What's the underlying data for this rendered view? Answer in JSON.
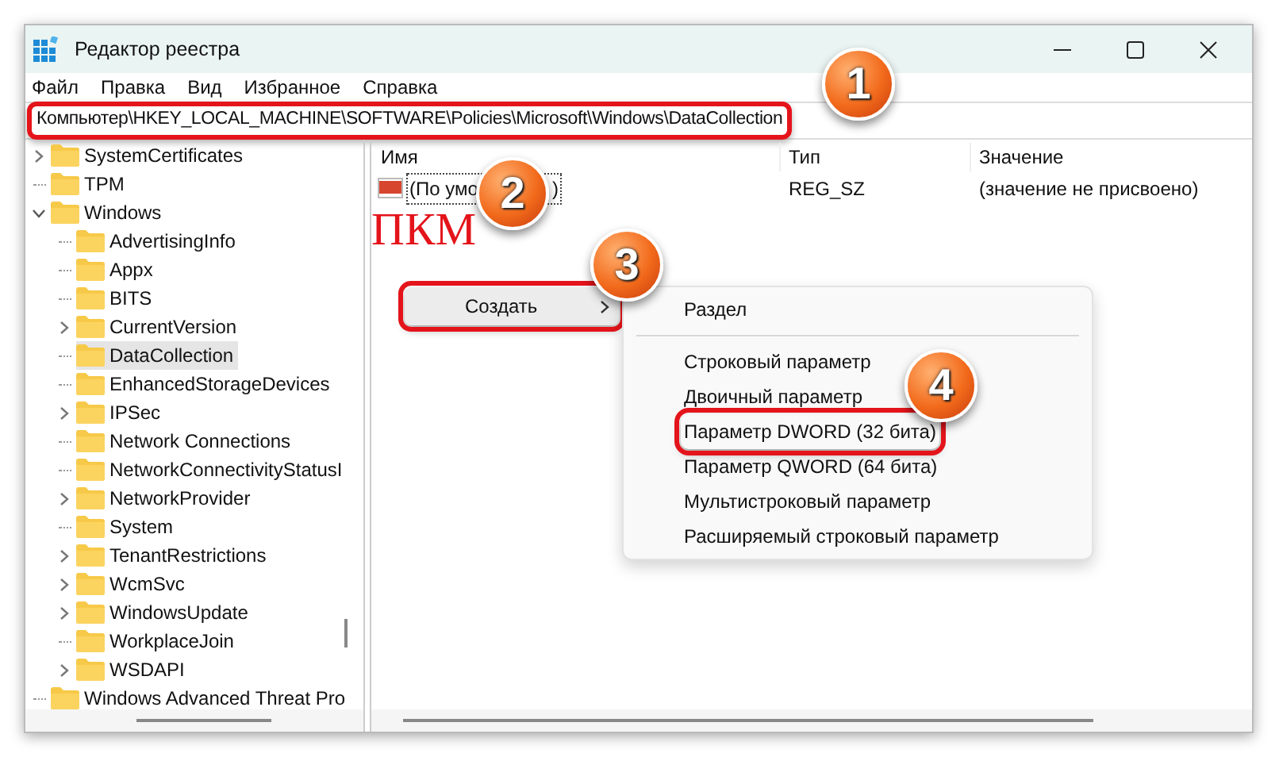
{
  "window": {
    "title": "Редактор реестра"
  },
  "menu": [
    "Файл",
    "Правка",
    "Вид",
    "Избранное",
    "Справка"
  ],
  "address_bar": {
    "value": "Компьютер\\HKEY_LOCAL_MACHINE\\SOFTWARE\\Policies\\Microsoft\\Windows\\DataCollection",
    "highlighted": true
  },
  "tree": [
    {
      "label": "SystemCertificates",
      "expandable": true,
      "expanded": false,
      "selected": false
    },
    {
      "label": "TPM",
      "expandable": false,
      "selected": false
    },
    {
      "label": "Windows",
      "expandable": true,
      "expanded": true,
      "selected": false,
      "children": [
        {
          "label": "AdvertisingInfo",
          "expandable": false,
          "selected": false
        },
        {
          "label": "Appx",
          "expandable": false,
          "selected": false
        },
        {
          "label": "BITS",
          "expandable": false,
          "selected": false
        },
        {
          "label": "CurrentVersion",
          "expandable": true,
          "expanded": false,
          "selected": false
        },
        {
          "label": "DataCollection",
          "expandable": false,
          "selected": true
        },
        {
          "label": "EnhancedStorageDevices",
          "expandable": false,
          "selected": false
        },
        {
          "label": "IPSec",
          "expandable": true,
          "expanded": false,
          "selected": false
        },
        {
          "label": "Network Connections",
          "expandable": false,
          "selected": false
        },
        {
          "label": "NetworkConnectivityStatusI",
          "expandable": false,
          "selected": false
        },
        {
          "label": "NetworkProvider",
          "expandable": true,
          "expanded": false,
          "selected": false
        },
        {
          "label": "System",
          "expandable": false,
          "selected": false
        },
        {
          "label": "TenantRestrictions",
          "expandable": true,
          "expanded": false,
          "selected": false
        },
        {
          "label": "WcmSvc",
          "expandable": true,
          "expanded": false,
          "selected": false
        },
        {
          "label": "WindowsUpdate",
          "expandable": true,
          "expanded": false,
          "selected": false
        },
        {
          "label": "WorkplaceJoin",
          "expandable": false,
          "selected": false
        },
        {
          "label": "WSDAPI",
          "expandable": true,
          "expanded": false,
          "selected": false
        }
      ]
    },
    {
      "label": "Windows Advanced Threat Pro",
      "expandable": false,
      "selected": false
    }
  ],
  "table": {
    "columns": [
      "Имя",
      "Тип",
      "Значение"
    ],
    "rows": [
      {
        "name": "(По умо",
        "name_end": ")",
        "type": "REG_SZ",
        "value": "(значение не присвоено)"
      }
    ]
  },
  "context_menu": {
    "items": [
      {
        "label": "Создать",
        "highlighted": true
      }
    ]
  },
  "submenu": {
    "items": [
      {
        "kind": "item",
        "label": "Раздел",
        "highlighted": false
      },
      {
        "kind": "separator"
      },
      {
        "kind": "item",
        "label": "Строковый параметр",
        "highlighted": false
      },
      {
        "kind": "item",
        "label": "Двоичный параметр",
        "highlighted": false
      },
      {
        "kind": "item",
        "label": "Параметр DWORD (32 бита)",
        "highlighted": true
      },
      {
        "kind": "item",
        "label": "Параметр QWORD (64 бита)",
        "highlighted": false
      },
      {
        "kind": "item",
        "label": "Мультистроковый параметр",
        "highlighted": false
      },
      {
        "kind": "item",
        "label": "Расширяемый строковый параметр",
        "highlighted": false
      }
    ]
  },
  "annotations": {
    "label": "ПКМ",
    "badges": [
      "1",
      "2",
      "3",
      "4"
    ]
  }
}
